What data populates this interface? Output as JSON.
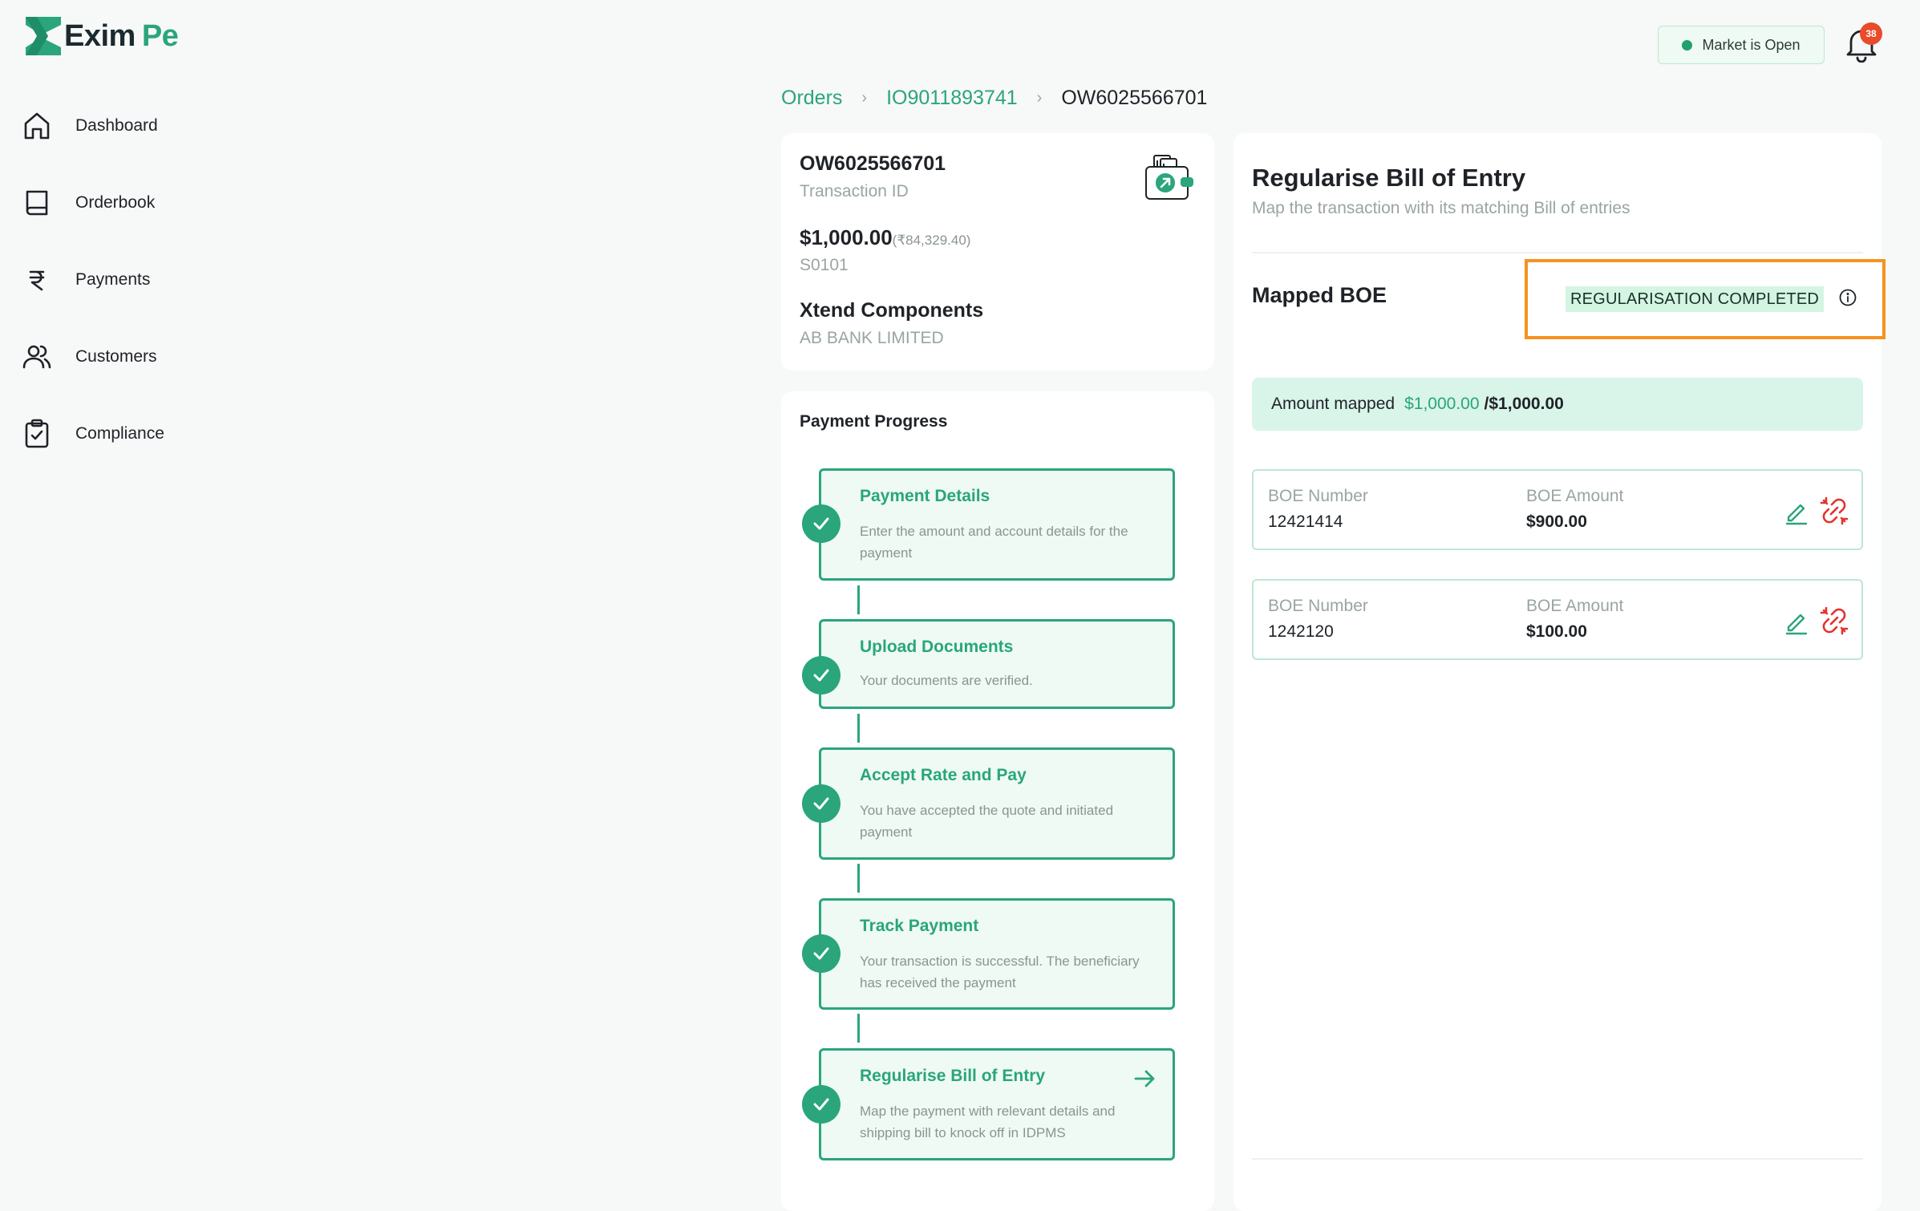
{
  "brand": {
    "name_part1": "Exim",
    "name_part2": "Pe",
    "accent": "#2aa57c",
    "dark": "#1b2a2f"
  },
  "sidebar": {
    "items": [
      {
        "label": "Dashboard",
        "icon": "home-icon"
      },
      {
        "label": "Orderbook",
        "icon": "book-icon"
      },
      {
        "label": "Payments",
        "icon": "rupee-icon"
      },
      {
        "label": "Customers",
        "icon": "users-icon"
      },
      {
        "label": "Compliance",
        "icon": "clipboard-check-icon"
      }
    ]
  },
  "topbar": {
    "market_status": "Market is Open",
    "notification_count": "38"
  },
  "breadcrumb": {
    "root": "Orders",
    "parent": "IO9011893741",
    "current": "OW6025566701"
  },
  "transaction": {
    "id": "OW6025566701",
    "id_label": "Transaction ID",
    "amount": "$1,000.00",
    "amount_inr": "(₹84,329.40)",
    "code": "S0101",
    "party": "Xtend Components",
    "bank": "AB BANK LIMITED"
  },
  "progress": {
    "title": "Payment Progress",
    "steps": [
      {
        "title": "Payment Details",
        "desc": "Enter the amount and account details for the payment"
      },
      {
        "title": "Upload Documents",
        "desc": "Your documents are verified."
      },
      {
        "title": "Accept Rate and Pay",
        "desc": "You have accepted the quote and initiated payment"
      },
      {
        "title": "Track Payment",
        "desc": "Your transaction is successful. The beneficiary has received the payment"
      },
      {
        "title": "Regularise Bill of Entry",
        "desc": "Map the payment with relevant details and shipping bill to knock off in IDPMS"
      }
    ]
  },
  "boe_panel": {
    "title": "Regularise Bill of Entry",
    "subtitle": "Map the transaction with its matching Bill of entries",
    "mapped_title": "Mapped BOE",
    "status": "REGULARISATION COMPLETED",
    "amount_mapped_label": "Amount mapped",
    "amount_mapped_value": "$1,000.00",
    "amount_mapped_total": "/$1,000.00",
    "number_label": "BOE Number",
    "amount_label": "BOE Amount",
    "entries": [
      {
        "number": "12421414",
        "amount": "$900.00"
      },
      {
        "number": "1242120",
        "amount": "$100.00"
      }
    ]
  }
}
